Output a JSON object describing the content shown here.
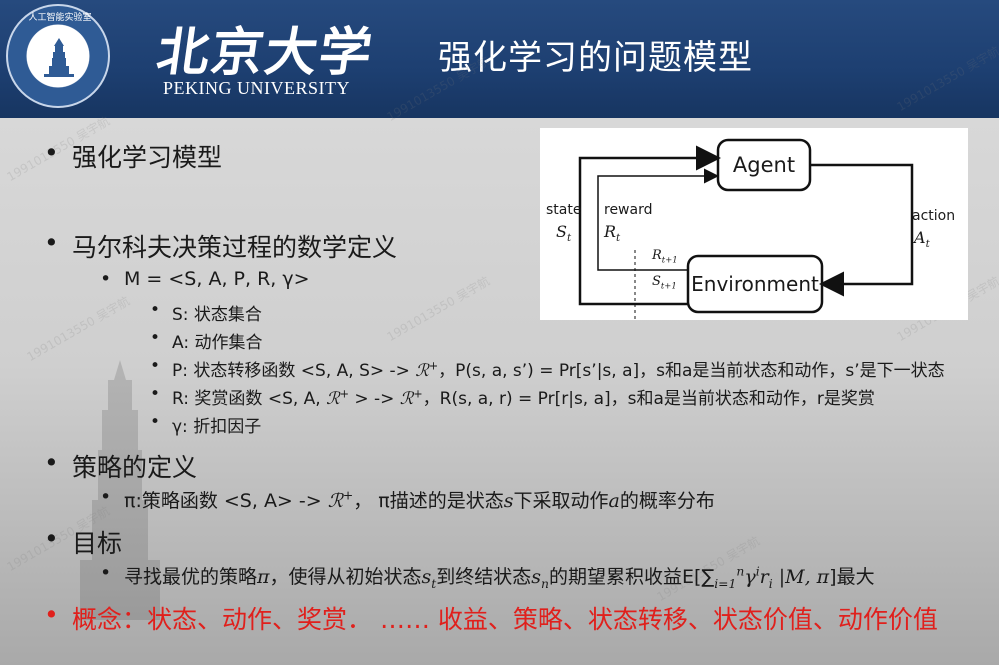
{
  "header": {
    "seal_text": "人工智能实验室",
    "univ_cn": "北京大学",
    "univ_en": "PEKING UNIVERSITY",
    "title": "强化学习的问题模型"
  },
  "diagram": {
    "agent": "Agent",
    "environment": "Environment",
    "state_label": "state",
    "state_sym": "S",
    "state_sub": "t",
    "reward_label": "reward",
    "reward_sym": "R",
    "reward_sub": "t",
    "action_label": "action",
    "action_sym": "A",
    "action_sub": "t",
    "r_next": "R",
    "r_next_sub": "t+1",
    "s_next": "S",
    "s_next_sub": "t+1"
  },
  "content": {
    "b1": "强化学习模型",
    "b2": "马尔科夫决策过程的数学定义",
    "b2_sub": "M = <S, A, P, R, γ>",
    "b2_items": {
      "s": "S: 状态集合",
      "a": "A: 动作集合",
      "p_pre": "P: 状态转移函数 <S, A, S> -> ",
      "p_sym": "ℛ",
      "p_sup": "+",
      "p_post": "，P(s, a, s’) = Pr[s’|s, a]，s和a是当前状态和动作，s’是下一状态",
      "r_pre": "R: 奖赏函数 <S, A, ",
      "r_sym": "ℛ",
      "r_sup": "+",
      "r_mid": " > -> ",
      "r_sym2": "ℛ",
      "r_sup2": "+",
      "r_post": "，R(s, a, r) = Pr[r|s, a]，s和a是当前状态和动作，r是奖赏",
      "g": "γ: 折扣因子"
    },
    "b3": "策略的定义",
    "b3_pre": "π:策略函数 <S, A> -> ",
    "b3_sym": "ℛ",
    "b3_sup": "+",
    "b3_mid": "，  π描述的是状态",
    "b3_s": "s",
    "b3_mid2": "下采取动作",
    "b3_a": "a",
    "b3_post": "的概率分布",
    "b4": "目标",
    "b4_pre": "寻找最优的策略",
    "b4_pi": "π",
    "b4_mid": "，使得从初始状态",
    "b4_s": "s",
    "b4_s_sub": "t",
    "b4_mid2": "到终结状态",
    "b4_sn": "s",
    "b4_sn_sub": "n",
    "b4_mid3": "的期望累积收益E[",
    "b4_sum": "∑",
    "b4_sum_sub": "i=1",
    "b4_sum_sup": "n",
    "b4_gamma": "γ",
    "b4_gamma_sup": "i",
    "b4_r": "r",
    "b4_r_sub": "i",
    "b4_cond": " |M, π",
    "b4_post": "]最大",
    "b5": "概念：状态、动作、奖赏．  ……    收益、策略、状态转移、状态价值、动作价值"
  },
  "watermark": "1991013550 吴宇航",
  "colors": {
    "header": "#1d3f71",
    "accent_red": "#e0201c",
    "background": "#d3d3d3"
  }
}
